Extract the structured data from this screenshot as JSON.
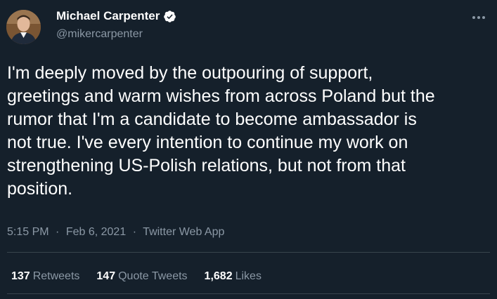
{
  "author": {
    "display_name": "Michael Carpenter",
    "handle": "@mikercarpenter",
    "verified": true
  },
  "tweet": {
    "text": "I'm deeply moved by the outpouring of support,\ngreetings and warm wishes from across Poland but the\nrumor that I'm a candidate to become ambassador is\nnot true. I've every intention to continue my work on\nstrengthening US-Polish relations, but not from that\nposition.",
    "time": "5:15 PM",
    "separator": "·",
    "date": "Feb 6, 2021",
    "source": "Twitter Web App"
  },
  "stats": {
    "retweets": {
      "count": "137",
      "label": "Retweets"
    },
    "quote_tweets": {
      "count": "147",
      "label": "Quote Tweets"
    },
    "likes": {
      "count": "1,682",
      "label": "Likes"
    }
  },
  "colors": {
    "background": "#15202b",
    "secondary_text": "#8b98a5",
    "verified_badge": "#ffffff",
    "divider": "#38444d"
  },
  "icons": [
    "verified-badge-icon",
    "more-options-icon"
  ]
}
